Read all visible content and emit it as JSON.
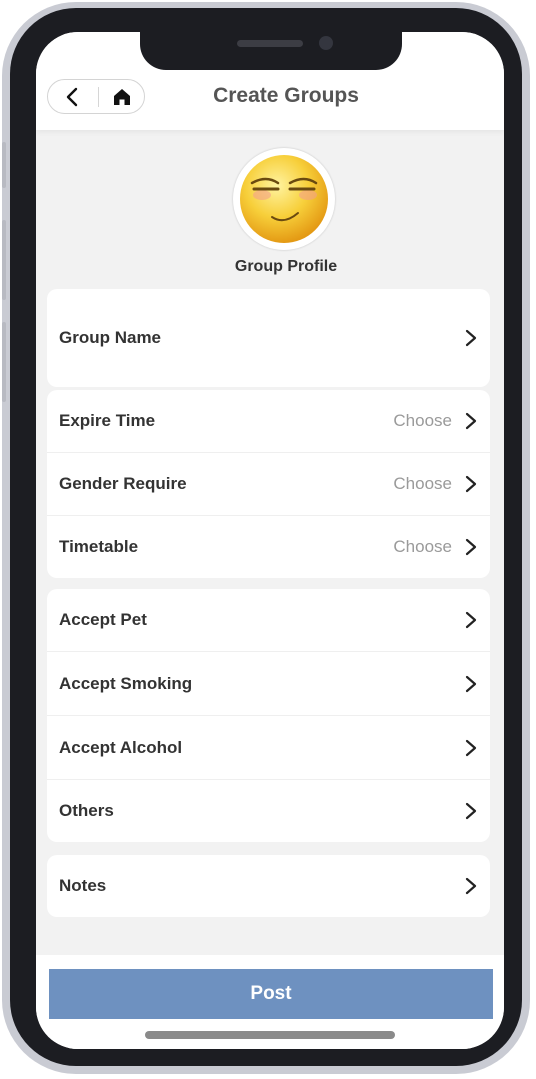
{
  "header": {
    "title": "Create Groups",
    "back_icon": "chevron-left-icon",
    "home_icon": "home-icon"
  },
  "profile": {
    "label": "Group Profile",
    "avatar": "smirking-emoji-avatar"
  },
  "rows": [
    {
      "label": "Group Name",
      "value": ""
    },
    {
      "label": "Expire Time",
      "value": "Choose"
    },
    {
      "label": "Gender Require",
      "value": "Choose"
    },
    {
      "label": "Timetable",
      "value": "Choose"
    },
    {
      "label": "Accept Pet",
      "value": ""
    },
    {
      "label": "Accept Smoking",
      "value": ""
    },
    {
      "label": "Accept Alcohol",
      "value": ""
    },
    {
      "label": "Others",
      "value": ""
    },
    {
      "label": "Notes",
      "value": ""
    }
  ],
  "footer": {
    "post_label": "Post"
  },
  "colors": {
    "accent": "#6e91c0",
    "background": "#f2f2f2",
    "title": "#555555"
  }
}
